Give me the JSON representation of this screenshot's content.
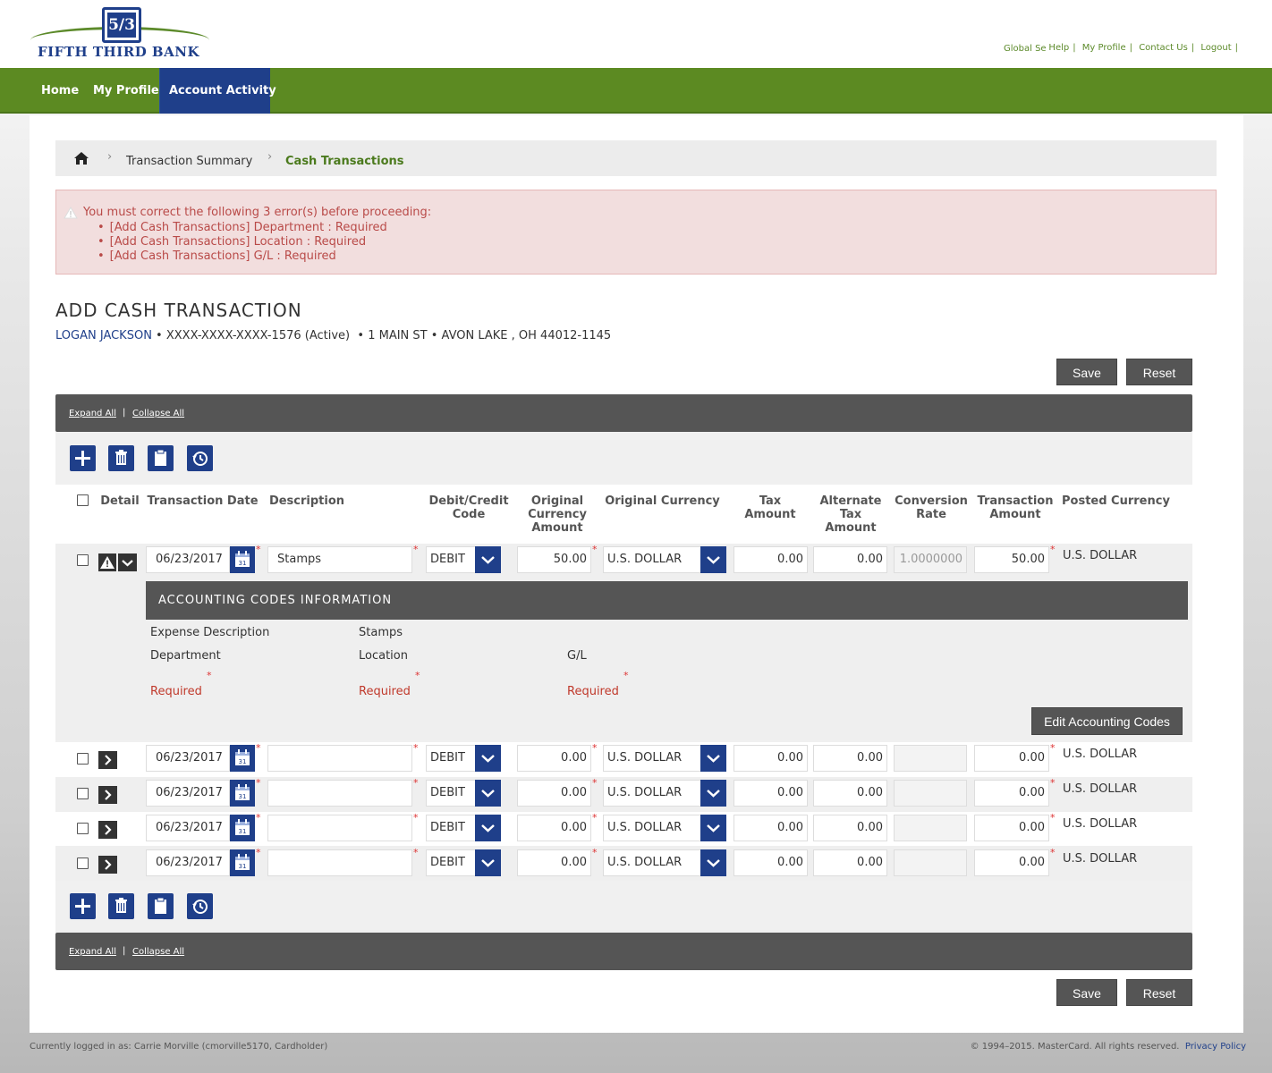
{
  "brand": {
    "name": "Fifth Third Bank",
    "logo_mark": "5/3",
    "colors": {
      "green": "#5c8a22",
      "blue": "#1f3f8a",
      "dark": "#555555",
      "error": "#b94a48"
    }
  },
  "utility_nav": {
    "global_search": "Global Se",
    "items": [
      "Help",
      "My Profile",
      "Contact Us",
      "Logout"
    ]
  },
  "main_nav": {
    "items": [
      "Home",
      "My Profile",
      "Account Activity"
    ],
    "active": "Account Activity"
  },
  "breadcrumb": {
    "items": [
      "Transaction Summary",
      "Cash Transactions"
    ]
  },
  "errors": {
    "message": "You must correct the following 3 error(s) before proceeding:",
    "items": [
      "[Add Cash Transactions] Department : Required",
      "[Add Cash Transactions] Location : Required",
      "[Add Cash Transactions] G/L : Required"
    ]
  },
  "page": {
    "title": "ADD CASH TRANSACTION",
    "account_name": "LOGAN JACKSON",
    "account_details": " • XXXX-XXXX-XXXX-1576 (Active)  • 1 MAIN ST • AVON LAKE , OH 44012-1145"
  },
  "actions": {
    "save": "Save",
    "reset": "Reset"
  },
  "grid_links": {
    "expand_all": "Expand All",
    "collapse_all": "Collapse All"
  },
  "toolbar_icons": [
    "add-icon",
    "trash-icon",
    "clipboard-icon",
    "history-icon"
  ],
  "columns": {
    "detail": "Detail",
    "transaction_date": "Transaction Date",
    "description": "Description",
    "debit_credit_1": "Debit/Credit",
    "debit_credit_2": "Code",
    "orig_amt_1": "Original",
    "orig_amt_2": "Currency",
    "orig_amt_3": "Amount",
    "original_currency": "Original Currency",
    "tax_1": "Tax",
    "tax_2": "Amount",
    "alt_tax_1": "Alternate",
    "alt_tax_2": "Tax",
    "alt_tax_3": "Amount",
    "conv_1": "Conversion",
    "conv_2": "Rate",
    "trans_amt_1": "Transaction",
    "trans_amt_2": "Amount",
    "posted_currency": "Posted Currency"
  },
  "rows": [
    {
      "date": "06/23/2017",
      "description": "Stamps",
      "code": "DEBIT",
      "orig_amount": "50.00",
      "orig_currency": "U.S. DOLLAR",
      "tax": "0.00",
      "alt_tax": "0.00",
      "conversion": "1.0000000",
      "trans_amount": "50.00",
      "posted_currency": "U.S. DOLLAR",
      "expanded": true,
      "warning": true
    },
    {
      "date": "06/23/2017",
      "description": "",
      "code": "DEBIT",
      "orig_amount": "0.00",
      "orig_currency": "U.S. DOLLAR",
      "tax": "0.00",
      "alt_tax": "0.00",
      "conversion": "",
      "trans_amount": "0.00",
      "posted_currency": "U.S. DOLLAR"
    },
    {
      "date": "06/23/2017",
      "description": "",
      "code": "DEBIT",
      "orig_amount": "0.00",
      "orig_currency": "U.S. DOLLAR",
      "tax": "0.00",
      "alt_tax": "0.00",
      "conversion": "",
      "trans_amount": "0.00",
      "posted_currency": "U.S. DOLLAR"
    },
    {
      "date": "06/23/2017",
      "description": "",
      "code": "DEBIT",
      "orig_amount": "0.00",
      "orig_currency": "U.S. DOLLAR",
      "tax": "0.00",
      "alt_tax": "0.00",
      "conversion": "",
      "trans_amount": "0.00",
      "posted_currency": "U.S. DOLLAR"
    },
    {
      "date": "06/23/2017",
      "description": "",
      "code": "DEBIT",
      "orig_amount": "0.00",
      "orig_currency": "U.S. DOLLAR",
      "tax": "0.00",
      "alt_tax": "0.00",
      "conversion": "",
      "trans_amount": "0.00",
      "posted_currency": "U.S. DOLLAR"
    }
  ],
  "accounting": {
    "title": "ACCOUNTING CODES INFORMATION",
    "expense_label": "Expense Description",
    "expense_value": "Stamps",
    "department_label": "Department",
    "location_label": "Location",
    "gl_label": "G/L",
    "required": "Required",
    "edit_button": "Edit Accounting Codes"
  },
  "footer": {
    "logged_in": "Currently logged in as: Carrie Morville (cmorville5170, Cardholder)",
    "copyright": "© 1994–2015. MasterCard. All rights reserved.",
    "privacy": "Privacy Policy"
  }
}
